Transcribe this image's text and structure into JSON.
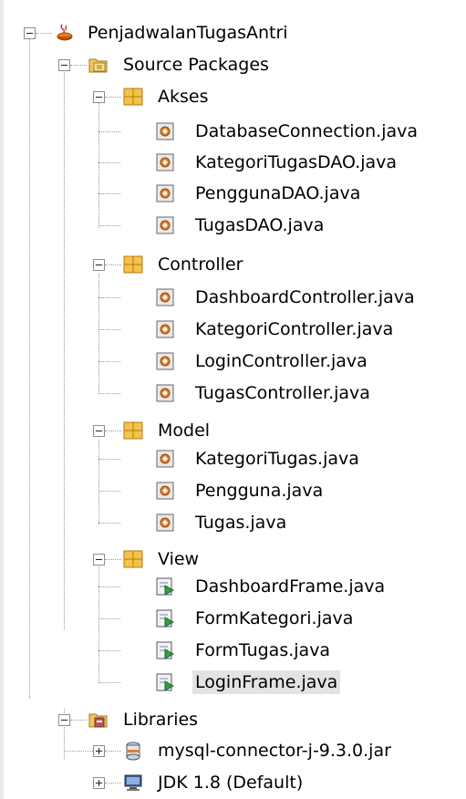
{
  "tree": {
    "project": "PenjadwalanTugasAntri",
    "source_packages": "Source Packages",
    "packages": [
      {
        "name": "Akses",
        "files": [
          "DatabaseConnection.java",
          "KategoriTugasDAO.java",
          "PenggunaDAO.java",
          "TugasDAO.java"
        ]
      },
      {
        "name": "Controller",
        "files": [
          "DashboardController.java",
          "KategoriController.java",
          "LoginController.java",
          "TugasController.java"
        ]
      },
      {
        "name": "Model",
        "files": [
          "KategoriTugas.java",
          "Pengguna.java",
          "Tugas.java"
        ]
      },
      {
        "name": "View",
        "files": [
          "DashboardFrame.java",
          "FormKategori.java",
          "FormTugas.java",
          "LoginFrame.java"
        ]
      }
    ],
    "libraries": "Libraries",
    "library_items": [
      "mysql-connector-j-9.3.0.jar",
      "JDK 1.8 (Default)"
    ],
    "selected_item": "LoginFrame.java"
  }
}
